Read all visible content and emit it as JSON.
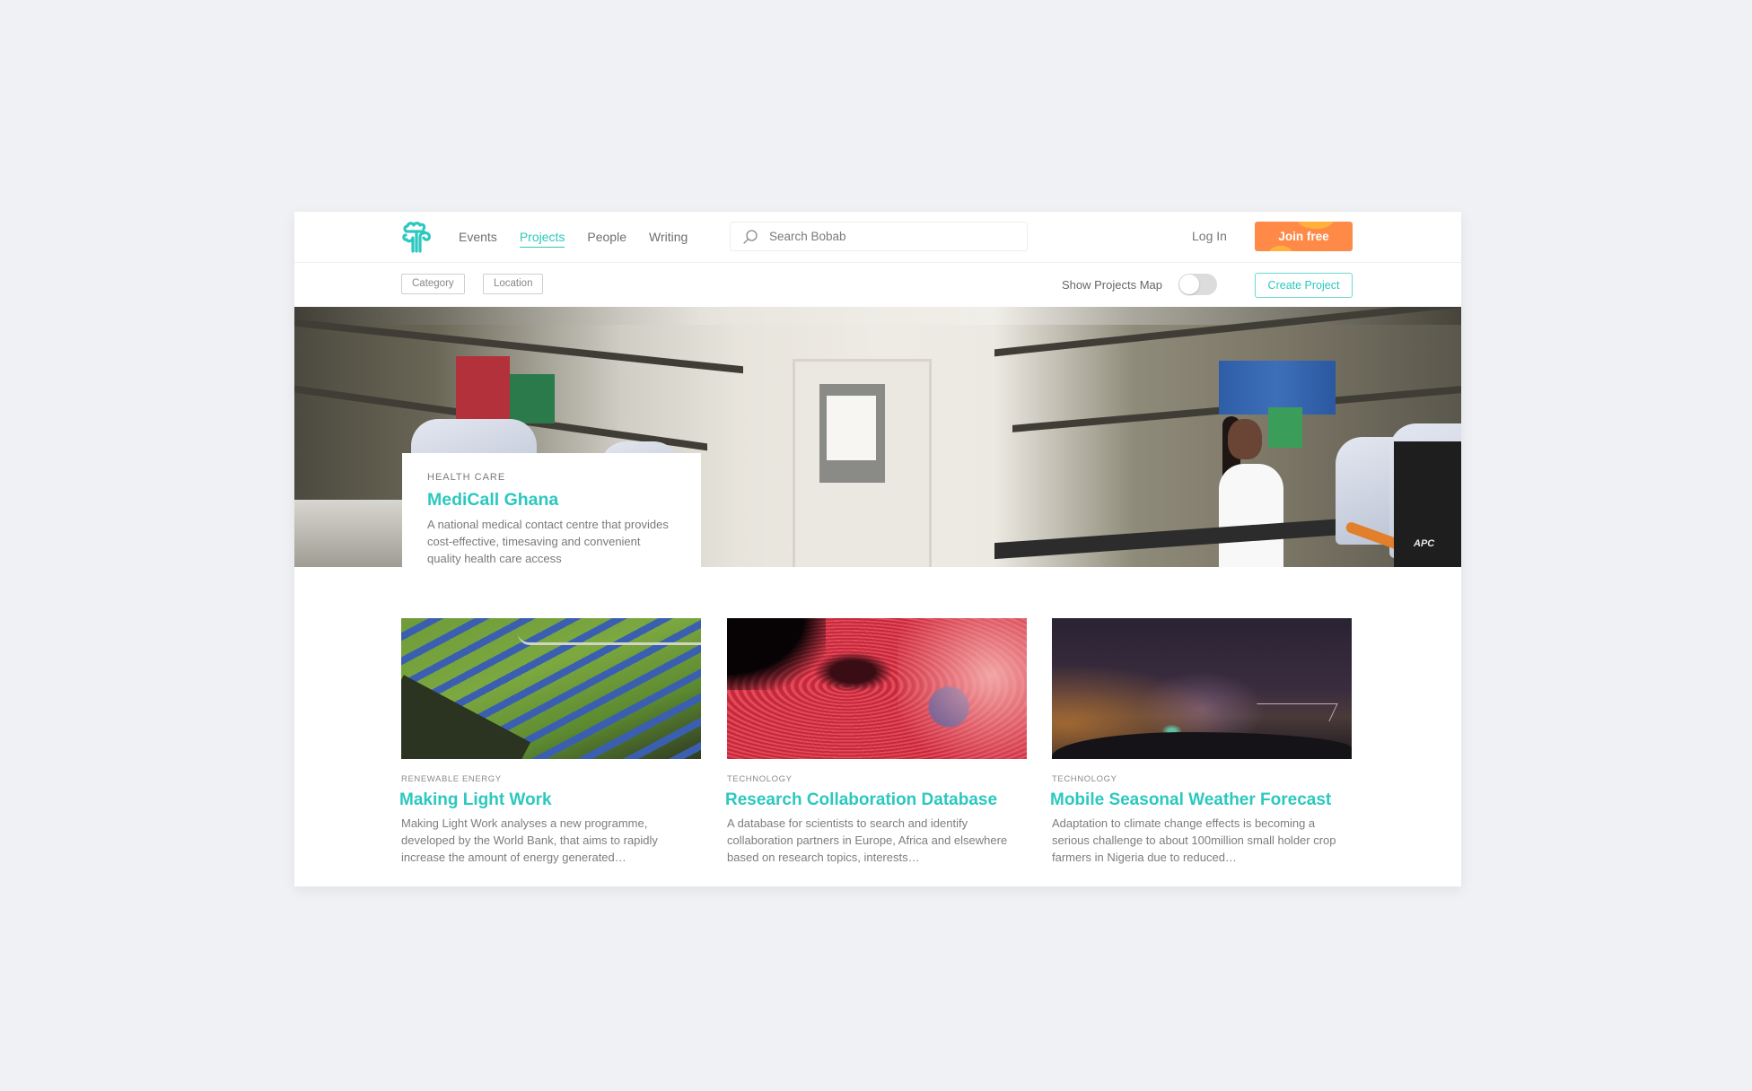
{
  "brand": {
    "name": "Bobab",
    "accent_color": "#2cc8bf",
    "cta_color": "#ff8a48"
  },
  "header": {
    "nav": [
      {
        "label": "Events",
        "active": false
      },
      {
        "label": "Projects",
        "active": true
      },
      {
        "label": "People",
        "active": false
      },
      {
        "label": "Writing",
        "active": false
      }
    ],
    "search": {
      "placeholder": "Search Bobab",
      "value": "",
      "icon": "search-icon"
    },
    "login_label": "Log In",
    "join_label": "Join free"
  },
  "filters": {
    "category_label": "Category",
    "location_label": "Location",
    "map_toggle_label": "Show Projects Map",
    "map_toggle_on": false,
    "create_project_label": "Create Project"
  },
  "featured": {
    "category": "HEALTH CARE",
    "title": "MediCall Ghana",
    "description": "A national medical contact centre that provides cost-effective, timesaving and convenient quality health care access",
    "image": "laboratory-photo"
  },
  "projects": [
    {
      "category": "RENEWABLE ENERGY",
      "title": "Making Light Work",
      "description": "Making Light Work analyses a new programme, developed by the World Bank, that aims to rapidly increase the amount of energy generated…",
      "image": "solar-farm-photo"
    },
    {
      "category": "TECHNOLOGY",
      "title": "Research Collaboration Database",
      "description": "A database for scientists to search and identify collaboration partners in Europe, Africa and elsewhere based on research topics, interests…",
      "image": "red-fluid-art-photo"
    },
    {
      "category": "TECHNOLOGY",
      "title": "Mobile Seasonal Weather Forecast",
      "description": "Adaptation to climate change effects is becoming a serious challenge to about 100million small holder crop farmers in Nigeria due to reduced…",
      "image": "night-storm-photo"
    }
  ],
  "hero_decor": {
    "ups_label": "APC"
  }
}
